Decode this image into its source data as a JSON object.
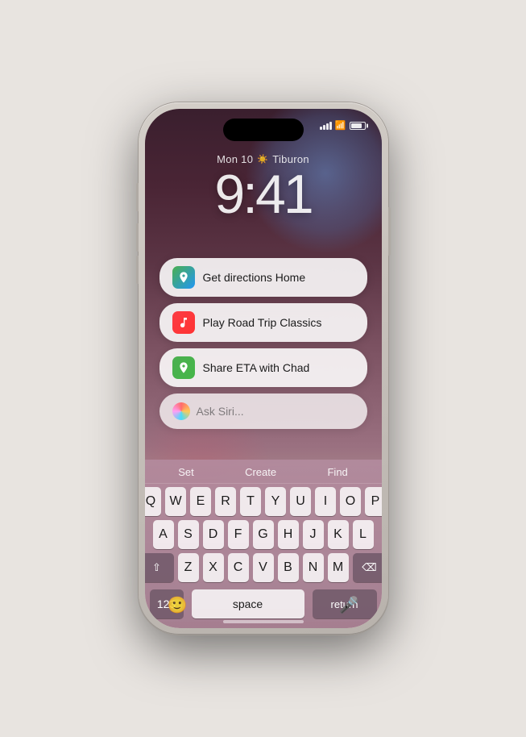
{
  "phone": {
    "status": {
      "date": "Mon 10",
      "weather": "Tiburon",
      "time": "9:41"
    },
    "suggestions": [
      {
        "id": "directions",
        "icon_type": "maps",
        "icon_char": "🗺",
        "text": "Get directions Home"
      },
      {
        "id": "music",
        "icon_type": "music",
        "icon_char": "♪",
        "text": "Play Road Trip Classics"
      },
      {
        "id": "maps2",
        "icon_type": "maps2",
        "icon_char": "📍",
        "text": "Share ETA with Chad"
      }
    ],
    "siri": {
      "placeholder": "Ask Siri..."
    },
    "keyboard": {
      "suggestions": [
        "Set",
        "Create",
        "Find"
      ],
      "rows": [
        [
          "Q",
          "W",
          "E",
          "R",
          "T",
          "Y",
          "U",
          "I",
          "O",
          "P"
        ],
        [
          "A",
          "S",
          "D",
          "F",
          "G",
          "H",
          "J",
          "K",
          "L"
        ],
        [
          "⇧",
          "Z",
          "X",
          "C",
          "V",
          "B",
          "N",
          "M",
          "⌫"
        ]
      ],
      "bottom": [
        "123",
        "space",
        "return"
      ]
    }
  }
}
